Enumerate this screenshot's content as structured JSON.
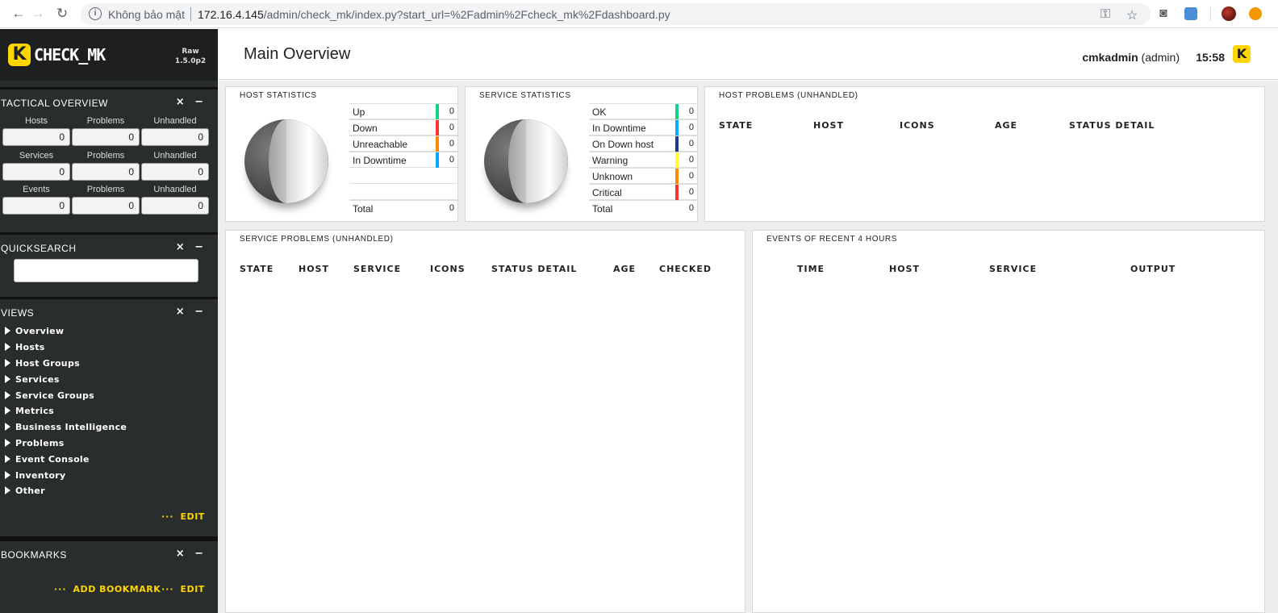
{
  "browser": {
    "security_label": "Không bảo mật",
    "url_host": "172.16.4.145",
    "url_path": "/admin/check_mk/index.py?start_url=%2Fadmin%2Fcheck_mk%2Fdashboard.py"
  },
  "sidebar": {
    "logo_text": "CHECK_MK",
    "edition": "Raw",
    "version": "1.5.0p2",
    "tactical": {
      "title": "TACTICAL OVERVIEW",
      "rows": [
        {
          "labels": [
            "Hosts",
            "Problems",
            "Unhandled"
          ],
          "values": [
            "0",
            "0",
            "0"
          ]
        },
        {
          "labels": [
            "Services",
            "Problems",
            "Unhandled"
          ],
          "values": [
            "0",
            "0",
            "0"
          ]
        },
        {
          "labels": [
            "Events",
            "Problems",
            "Unhandled"
          ],
          "values": [
            "0",
            "0",
            "0"
          ]
        }
      ]
    },
    "quicksearch": {
      "title": "QUICKSEARCH",
      "value": ""
    },
    "views": {
      "title": "VIEWS",
      "items": [
        "Overview",
        "Hosts",
        "Host Groups",
        "Services",
        "Service Groups",
        "Metrics",
        "Business Intelligence",
        "Problems",
        "Event Console",
        "Inventory",
        "Other"
      ],
      "edit_label": "EDIT"
    },
    "bookmarks": {
      "title": "BOOKMARKS",
      "add_label": "ADD BOOKMARK",
      "edit_label": "EDIT"
    },
    "snapin_controls": "× −",
    "link_dots": "···"
  },
  "header": {
    "title": "Main Overview",
    "user": "cmkadmin",
    "role": "(admin)",
    "time": "15:58"
  },
  "dashlets": {
    "host_stats": {
      "title": "HOST STATISTICS",
      "rows": [
        {
          "label": "Up",
          "value": "0",
          "color": "#13d389"
        },
        {
          "label": "Down",
          "value": "0",
          "color": "#ff3232"
        },
        {
          "label": "Unreachable",
          "value": "0",
          "color": "#ff8800"
        },
        {
          "label": "In Downtime",
          "value": "0",
          "color": "#00aaff"
        }
      ],
      "total_label": "Total",
      "total_value": "0"
    },
    "service_stats": {
      "title": "SERVICE STATISTICS",
      "rows": [
        {
          "label": "OK",
          "value": "0",
          "color": "#13d389"
        },
        {
          "label": "In Downtime",
          "value": "0",
          "color": "#00aaff"
        },
        {
          "label": "On Down host",
          "value": "0",
          "color": "#1a3a8a"
        },
        {
          "label": "Warning",
          "value": "0",
          "color": "#ffff30"
        },
        {
          "label": "Unknown",
          "value": "0",
          "color": "#ff8800"
        },
        {
          "label": "Critical",
          "value": "0",
          "color": "#ff3232"
        }
      ],
      "total_label": "Total",
      "total_value": "0"
    },
    "host_problems": {
      "title": "HOST PROBLEMS (UNHANDLED)",
      "columns": [
        "STATE",
        "HOST",
        "ICONS",
        "AGE",
        "STATUS DETAIL"
      ]
    },
    "service_problems": {
      "title": "SERVICE PROBLEMS (UNHANDLED)",
      "columns": [
        "STATE",
        "HOST",
        "SERVICE",
        "ICONS",
        "STATUS DETAIL",
        "AGE",
        "CHECKED"
      ]
    },
    "events": {
      "title": "EVENTS OF RECENT 4 HOURS",
      "columns": [
        "TIME",
        "HOST",
        "SERVICE",
        "OUTPUT"
      ]
    }
  }
}
